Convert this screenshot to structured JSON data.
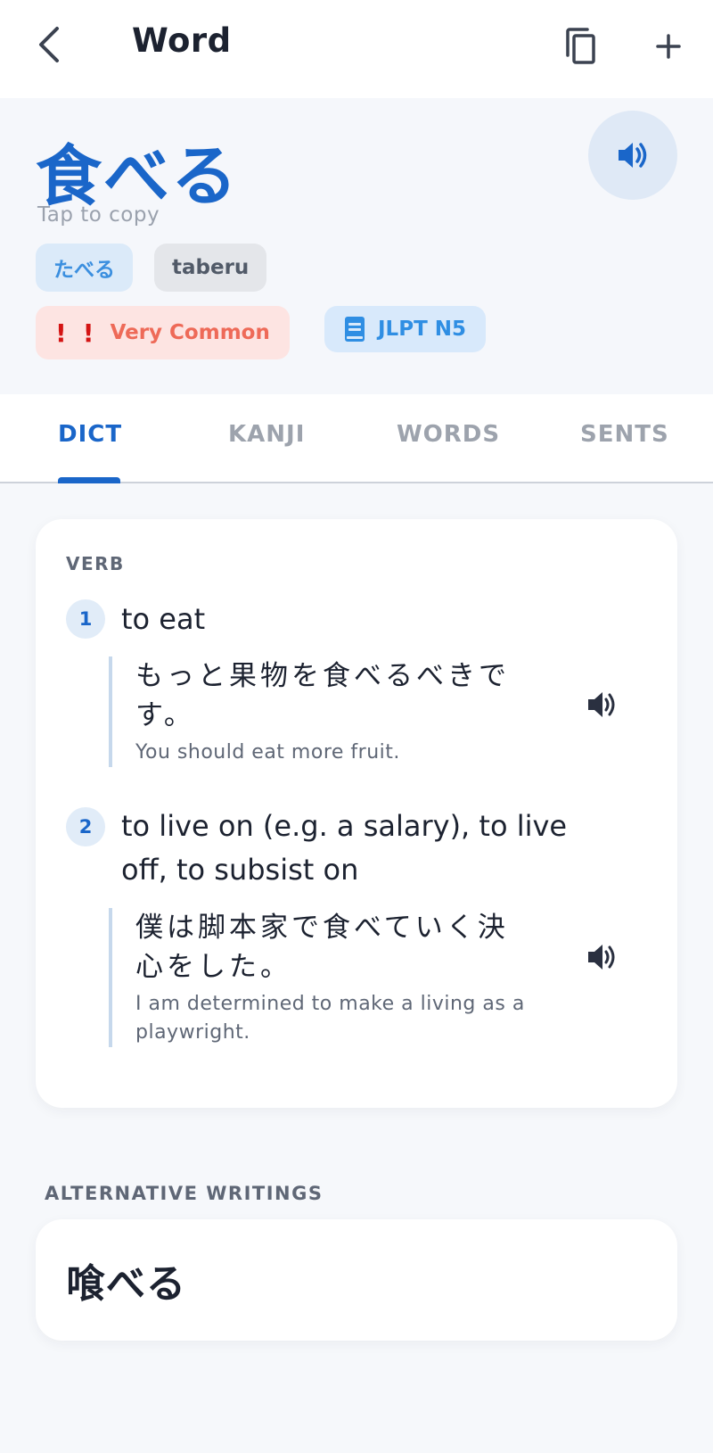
{
  "appbar": {
    "title": "Word",
    "back_icon": "chevron-left-icon",
    "copy_icon": "copy-icon",
    "add_icon": "plus-icon"
  },
  "word": {
    "main": "食べる",
    "tap_hint": "Tap to copy",
    "reading_kana": "たべる",
    "reading_romaji": "taberu",
    "frequency_marks": [
      "!",
      "!"
    ],
    "frequency_label": "Very Common",
    "jlpt_label": "JLPT N5"
  },
  "tabs": [
    {
      "label": "DICT",
      "active": true
    },
    {
      "label": "KANJI",
      "active": false
    },
    {
      "label": "WORDS",
      "active": false
    },
    {
      "label": "SENTS",
      "active": false
    }
  ],
  "definitions": {
    "pos": "VERB",
    "senses": [
      {
        "number": "1",
        "gloss_lines": [
          "to eat"
        ],
        "example_jp_lines": [
          "もっと果物を食べるべきで",
          "す。"
        ],
        "example_en_lines": [
          "You should eat more fruit."
        ]
      },
      {
        "number": "2",
        "gloss_lines": [
          "to live on (e.g. a salary), to live",
          "off, to subsist on"
        ],
        "example_jp_lines": [
          "僕は脚本家で食べていく決",
          "心をした。"
        ],
        "example_en_lines": [
          "I am determined to make a living as a",
          "playwright."
        ]
      }
    ]
  },
  "alternatives": {
    "label": "ALTERNATIVE WRITINGS",
    "items": [
      "喰べる"
    ]
  },
  "colors": {
    "accent": "#1a66c9",
    "kana_chip_bg": "#dbeaf9",
    "common_badge_bg": "#fde4e2",
    "common_text": "#ee6a58",
    "jlpt_badge_bg": "#d8e9fb"
  }
}
